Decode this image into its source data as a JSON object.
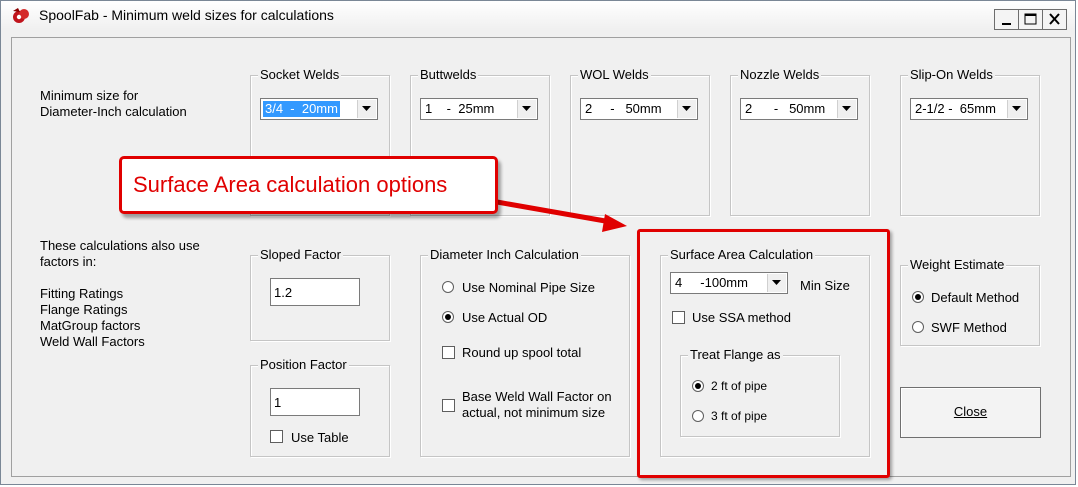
{
  "window": {
    "title": "SpoolFab - Minimum weld sizes for calculations",
    "minimize": "_",
    "maximize": "□",
    "close": "✕"
  },
  "intro": {
    "line1": "Minimum size for",
    "line2": "Diameter-Inch calculation"
  },
  "weld_groups": [
    {
      "title": "Socket Welds",
      "value": "3/4  -  20mm"
    },
    {
      "title": "Buttwelds",
      "value": "1    -  25mm"
    },
    {
      "title": "WOL Welds",
      "value": "2     -   50mm"
    },
    {
      "title": "Nozzle Welds",
      "value": "2      -   50mm"
    },
    {
      "title": "Slip-On Welds",
      "value": "2-1/2 -  65mm"
    }
  ],
  "factors_note": {
    "line1": "These calculations also use",
    "line2": "factors in:",
    "items": [
      "Fitting Ratings",
      "Flange Ratings",
      "MatGroup factors",
      "Weld Wall Factors"
    ]
  },
  "sloped_factor": {
    "title": "Sloped Factor",
    "value": "1.2"
  },
  "position_factor": {
    "title": "Position Factor",
    "value": "1",
    "use_table_label": "Use Table"
  },
  "diameter_inch": {
    "title": "Diameter Inch Calculation",
    "nominal_label": "Use Nominal Pipe Size",
    "actual_label": "Use Actual OD",
    "roundup_label": "Round up spool total",
    "base_label_1": "Base Weld Wall Factor on",
    "base_label_2": "actual, not minimum size"
  },
  "surface_area": {
    "title": "Surface Area Calculation",
    "min_value": "4     -100mm",
    "min_label": "Min Size",
    "ssa_label": "Use SSA method",
    "flange_title": "Treat Flange as",
    "opt2": "2 ft of pipe",
    "opt3": "3 ft of pipe"
  },
  "weight_estimate": {
    "title": "Weight Estimate",
    "default_label": "Default Method",
    "swf_label": "SWF Method"
  },
  "close_button": "Close",
  "callout": {
    "text": "Surface Area calculation options"
  },
  "colors": {
    "highlight": "#e00000",
    "selection": "#3399ff"
  }
}
